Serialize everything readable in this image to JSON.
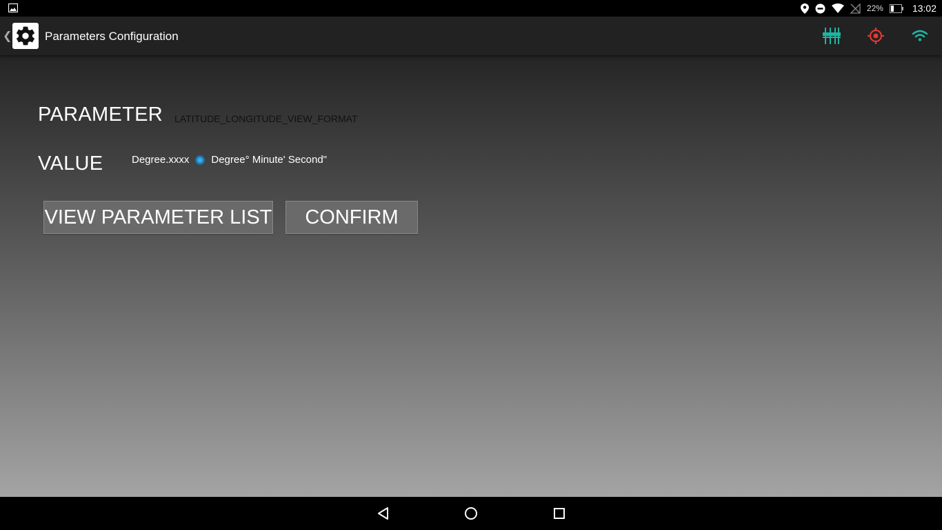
{
  "statusbar": {
    "battery_percent": "22%",
    "time": "13:02"
  },
  "actionbar": {
    "title": "Parameters Configuration",
    "accent_teal": "#1fb5a0",
    "accent_red": "#e53935"
  },
  "form": {
    "parameter_label": "PARAMETER",
    "parameter_value": "LATITUDE_LONGITUDE_VIEW_FORMAT",
    "value_label": "VALUE",
    "option_1": "Degree.xxxx",
    "option_2": "Degree° Minute' Second\""
  },
  "buttons": {
    "view_list": "VIEW PARAMETER LIST",
    "confirm": "CONFIRM"
  }
}
